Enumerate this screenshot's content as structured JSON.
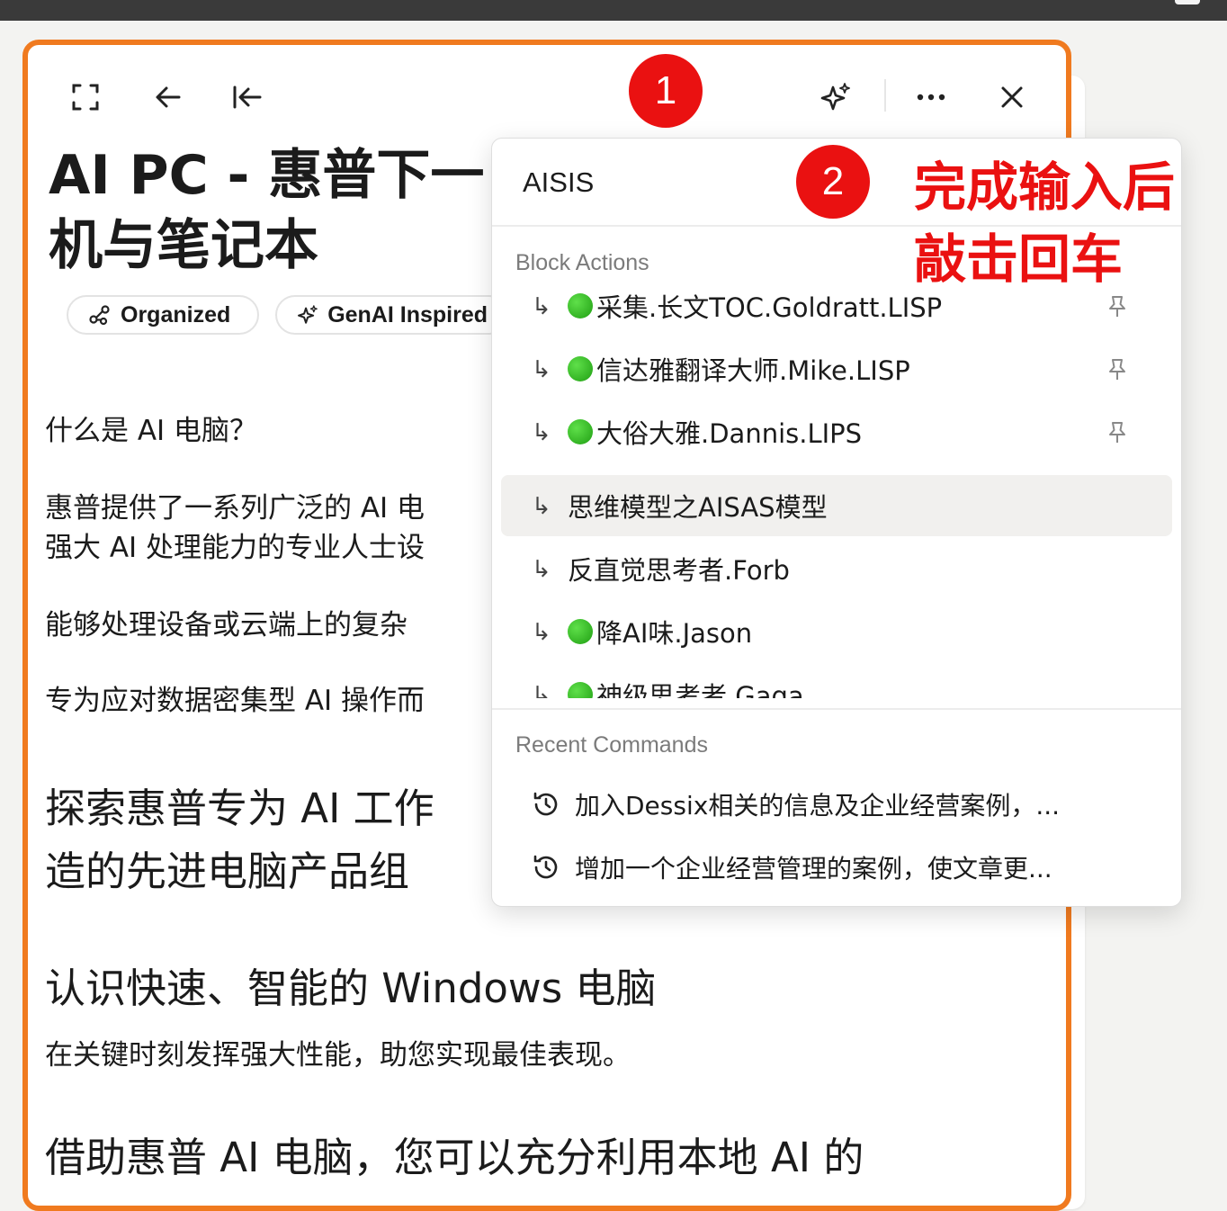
{
  "toolbar": {
    "icons": [
      "expand-icon",
      "arrow-left-icon",
      "collapse-to-left-icon",
      "sparkle-icon",
      "more-icon",
      "close-icon"
    ]
  },
  "doc": {
    "title_line1": "AI PC - 惠普下一",
    "title_line2": "机与笔记本",
    "tags": [
      {
        "label": "Organized",
        "icon": "organize-icon"
      },
      {
        "label": "GenAI Inspired",
        "icon": "sparkle-icon"
      }
    ],
    "p1": "什么是 AI 电脑？",
    "p2_line1": "惠普提供了一系列广泛的 AI 电",
    "p2_line2": "强大 AI 处理能力的专业人士设",
    "p3": "能够处理设备或云端上的复杂",
    "p4": "专为应对数据密集型 AI 操作而",
    "h2_line1": "探索惠普专为 AI 工作",
    "h2_line2": "造的先进电脑产品组",
    "h3": "认识快速、智能的 Windows 电脑",
    "p5": "在关键时刻发挥强大性能，助您实现最佳表现。",
    "p6": "借助惠普 AI 电脑，您可以充分利用本地 AI 的"
  },
  "popup": {
    "search_value": "AISIS",
    "block_actions_label": "Block Actions",
    "items": [
      {
        "label": "采集.长文TOC.Goldratt.LISP",
        "dot": true,
        "pinned": true
      },
      {
        "label": "信达雅翻译大师.Mike.LISP",
        "dot": true,
        "pinned": true
      },
      {
        "label": "大俗大雅.Dannis.LIPS",
        "dot": true,
        "pinned": true
      },
      {
        "label": "思维模型之AISAS模型",
        "dot": false,
        "pinned": false,
        "highlighted": true
      },
      {
        "label": "反直觉思考者.Forb",
        "dot": false,
        "pinned": false
      },
      {
        "label": "降AI味.Jason",
        "dot": true,
        "pinned": false
      },
      {
        "label": "神级思考者.Gaga",
        "dot": true,
        "pinned": false
      }
    ],
    "recent_label": "Recent Commands",
    "recent": [
      {
        "label": "加入Dessix相关的信息及企业经营案例，..."
      },
      {
        "label": "增加一个企业经营管理的案例，使文章更..."
      }
    ]
  },
  "annotations": {
    "badge1": "1",
    "badge2": "2",
    "note_line1": "完成输入后",
    "note_line2": "敲击回车",
    "color": "#ea1111"
  },
  "colors": {
    "panel_border": "#f07a1f",
    "highlight_bg": "#f1f0ee",
    "dot_green": "#2fb81f"
  }
}
